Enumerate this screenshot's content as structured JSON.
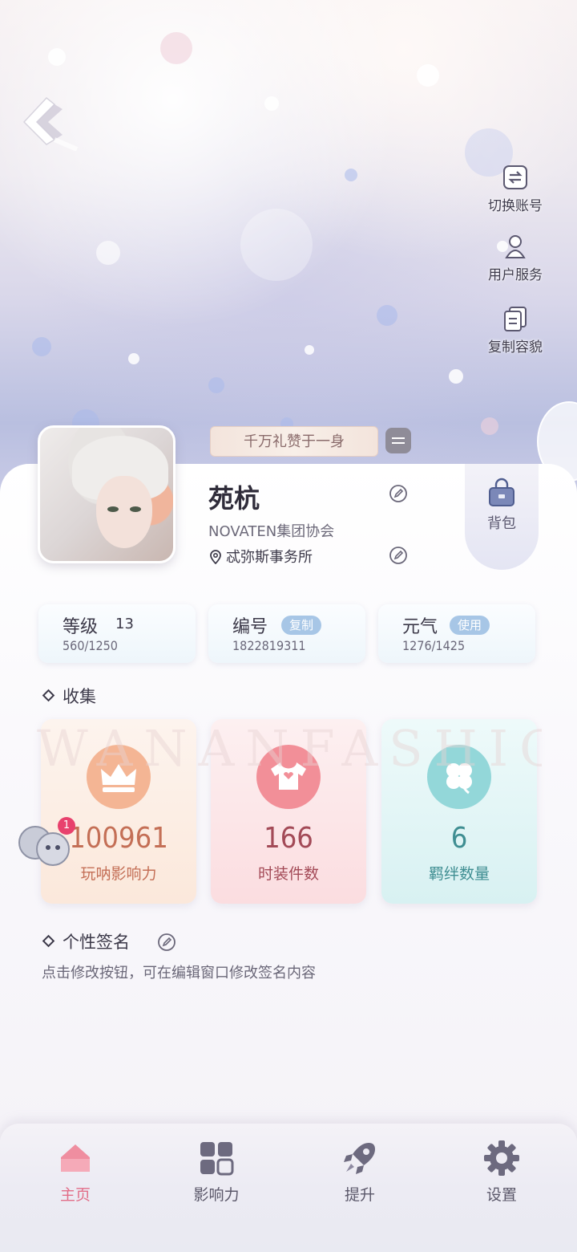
{
  "side_actions": {
    "switch_account": "切换账号",
    "user_service": "用户服务",
    "copy_look": "复制容貌"
  },
  "profile": {
    "title_badge": "千万礼赞于一身",
    "name": "苑杭",
    "organization": "NOVATEN集团协会",
    "location": "忒弥斯事务所",
    "bag_label": "背包"
  },
  "stats": {
    "level": {
      "label": "等级",
      "value": "13",
      "progress": "560/1250"
    },
    "id": {
      "label": "编号",
      "action": "复制",
      "value": "1822819311"
    },
    "energy": {
      "label": "元气",
      "action": "使用",
      "value": "1276/1425"
    }
  },
  "collection": {
    "title": "收集",
    "watermark": "WANANFASHIONBOND",
    "cards": [
      {
        "icon": "crown-icon",
        "value": "100961",
        "caption": "玩呐影响力",
        "color": "#f3b08c"
      },
      {
        "icon": "tshirt-icon",
        "value": "166",
        "caption": "时装件数",
        "color": "#f08a95"
      },
      {
        "icon": "clover-icon",
        "value": "6",
        "caption": "羁绊数量",
        "color": "#8fd6d8"
      }
    ],
    "badge_count": "1"
  },
  "signature": {
    "title": "个性签名",
    "hint": "点击修改按钮，可在编辑窗口修改签名内容"
  },
  "bottom_nav": [
    {
      "label": "主页",
      "icon": "home-icon",
      "active": true
    },
    {
      "label": "影响力",
      "icon": "grid-icon",
      "active": false
    },
    {
      "label": "提升",
      "icon": "rocket-icon",
      "active": false
    },
    {
      "label": "设置",
      "icon": "gear-icon",
      "active": false
    }
  ]
}
